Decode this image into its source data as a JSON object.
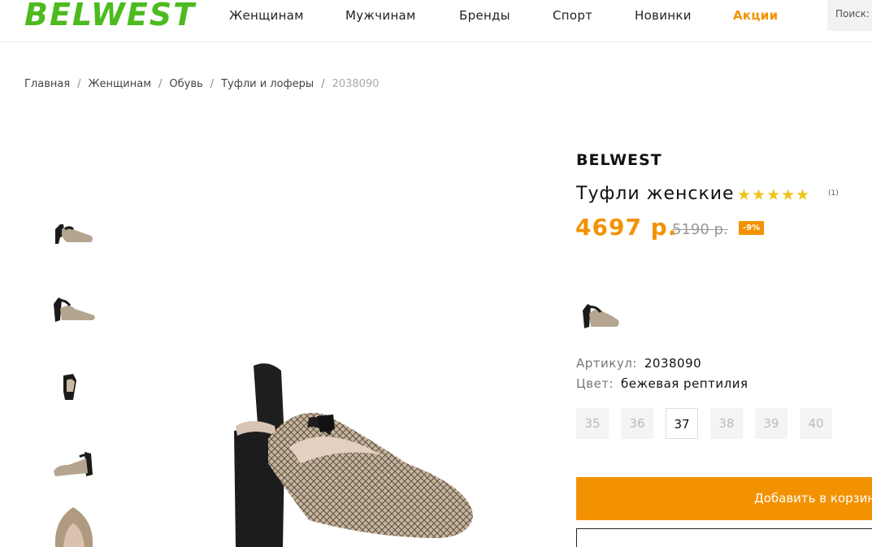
{
  "header": {
    "logo": "BELWEST",
    "nav": [
      "Женщинам",
      "Мужчинам",
      "Бренды",
      "Спорт",
      "Новинки",
      "Акции"
    ],
    "search_label": "Поиск:"
  },
  "breadcrumb": {
    "items": [
      "Главная",
      "Женщинам",
      "Обувь",
      "Туфли и лоферы"
    ],
    "current": "2038090",
    "separator": "/"
  },
  "product": {
    "brand": "BELWEST",
    "title": "Туфли женские",
    "stars": "★★★★★",
    "rating": 5,
    "rating_count": "(1)",
    "price": "4697 р.",
    "old_price": "5190 р.",
    "discount": "-9%",
    "article_label": "Артикул:",
    "article": "2038090",
    "color_label": "Цвет:",
    "color": "бежевая рептилия",
    "sizes": [
      "35",
      "36",
      "37",
      "38",
      "39",
      "40"
    ],
    "selected_size": "37",
    "add_to_cart": "Добавить в корзину"
  },
  "colors": {
    "accent": "#f39200",
    "logo": "#4dbb1f",
    "star": "#f0c419"
  }
}
